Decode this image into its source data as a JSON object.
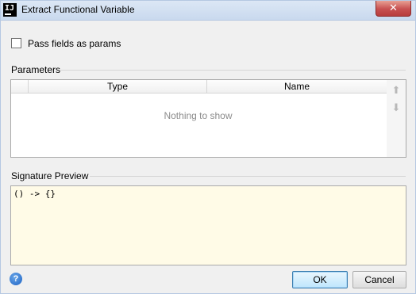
{
  "window": {
    "title": "Extract Functional Variable",
    "app_icon_text": "IJ",
    "close_symbol": "✕"
  },
  "options": {
    "pass_fields_label": "Pass fields as params",
    "pass_fields_checked": false
  },
  "parameters": {
    "section_title": "Parameters",
    "columns": [
      "Type",
      "Name"
    ],
    "rows": [],
    "empty_text": "Nothing to show",
    "move_up_symbol": "⬆",
    "move_down_symbol": "⬇"
  },
  "signature": {
    "section_title": "Signature Preview",
    "text": "() -> {}"
  },
  "footer": {
    "help_symbol": "?",
    "ok_label": "OK",
    "cancel_label": "Cancel"
  }
}
